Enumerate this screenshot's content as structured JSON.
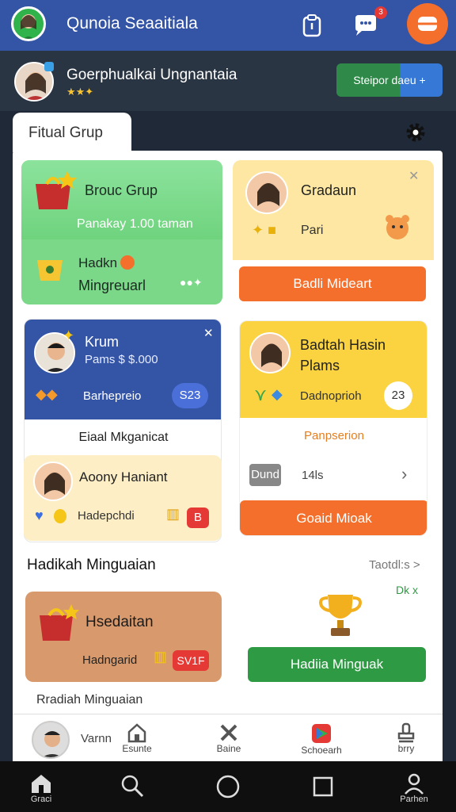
{
  "topbar": {
    "title": "Qunoia Seaaitiala",
    "badge": "3"
  },
  "profile": {
    "name": "Goerphualkai Ungnantaia",
    "stars": "★★✦",
    "button": "Steipor daeu +"
  },
  "tab": {
    "label": "Fitual Grup"
  },
  "cards": {
    "broad": {
      "title": "Brouc Grup",
      "subtitle": "Panakay 1.00 taman",
      "line1": "Hadkn",
      "line2": "Mingreuarl",
      "dots": "●●✦"
    },
    "gradaun": {
      "title": "Gradaun",
      "sub": "Pari",
      "button": "Badli Mideart"
    },
    "krum": {
      "title": "Krum",
      "sub": "Pams $ $.000",
      "row": "Barhepreio",
      "badge": "S23",
      "footer": "Eiaal Mkganicat"
    },
    "badtah": {
      "title1": "Badtah Hasin",
      "title2": "Plams",
      "row": "Dadnoprioh",
      "badge": "23",
      "link": "Panpserion",
      "tag": "Dund",
      "count": "14ls",
      "button": "Goaid Mioak"
    },
    "aoony": {
      "title": "Aoony Haniant",
      "row": "Hadepchdi",
      "badge": "B"
    }
  },
  "section": {
    "title": "Hadikah Minguaian",
    "link": "Taotdl:s >",
    "sub": "Dk x"
  },
  "hadiaitan": {
    "title": "Hsedaitan",
    "row": "Hadngarid",
    "badge": "SV1F"
  },
  "hadiabtn": {
    "label": "Hadiia Minguak"
  },
  "footer_text": "Rradiah Minguaian",
  "bottomnav": {
    "user": "Varnn",
    "items": [
      "Esunte",
      "Baine",
      "Schoearh",
      "brry"
    ]
  },
  "sysnav": {
    "home": "Graci",
    "profile": "Parhen"
  },
  "colors": {
    "blue": "#3454a6",
    "orange": "#f36f2b",
    "green": "#2f9a44",
    "yellow": "#fbd341"
  }
}
